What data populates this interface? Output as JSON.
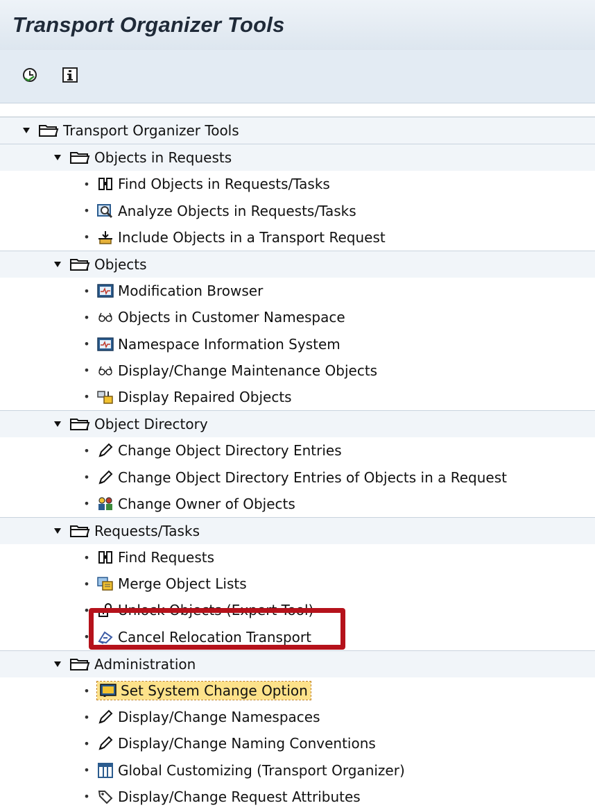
{
  "window": {
    "title": "Transport Organizer Tools"
  },
  "toolbar": {
    "execute_icon": "execute-clock-icon",
    "info_icon": "information-icon"
  },
  "tree": {
    "root": {
      "label": "Transport Organizer Tools"
    },
    "groups": [
      {
        "label": "Objects in Requests",
        "items": [
          {
            "label": "Find Objects in Requests/Tasks",
            "icon": "binoculars-icon"
          },
          {
            "label": "Analyze Objects in Requests/Tasks",
            "icon": "analyze-icon"
          },
          {
            "label": "Include Objects in a Transport Request",
            "icon": "include-arrow-icon"
          }
        ]
      },
      {
        "label": "Objects",
        "items": [
          {
            "label": "Modification Browser",
            "icon": "browser-chart-icon"
          },
          {
            "label": "Objects in Customer Namespace",
            "icon": "glasses-icon"
          },
          {
            "label": "Namespace Information System",
            "icon": "browser-chart-icon"
          },
          {
            "label": "Display/Change Maintenance Objects",
            "icon": "glasses-icon"
          },
          {
            "label": "Display Repaired Objects",
            "icon": "repaired-objects-icon"
          }
        ]
      },
      {
        "label": "Object Directory",
        "items": [
          {
            "label": "Change Object Directory Entries",
            "icon": "pencil-icon"
          },
          {
            "label": "Change Object Directory Entries of Objects in a Request",
            "icon": "pencil-icon"
          },
          {
            "label": "Change Owner of Objects",
            "icon": "users-icon"
          }
        ]
      },
      {
        "label": "Requests/Tasks",
        "items": [
          {
            "label": "Find Requests",
            "icon": "binoculars-icon"
          },
          {
            "label": "Merge Object Lists",
            "icon": "merge-lists-icon"
          },
          {
            "label": "Unlock Objects (Expert Tool)",
            "icon": "padlock-open-icon"
          },
          {
            "label": "Cancel Relocation Transport",
            "icon": "cancel-relocation-icon"
          }
        ]
      },
      {
        "label": "Administration",
        "items": [
          {
            "label": "Set System Change Option",
            "icon": "system-change-icon",
            "selected": true
          },
          {
            "label": "Display/Change Namespaces",
            "icon": "pencil-icon"
          },
          {
            "label": "Display/Change Naming Conventions",
            "icon": "pencil-icon"
          },
          {
            "label": "Global Customizing (Transport Organizer)",
            "icon": "table-grid-icon"
          },
          {
            "label": "Display/Change Request Attributes",
            "icon": "tag-icon"
          }
        ]
      }
    ]
  },
  "colors": {
    "highlight_border": "#b5121b",
    "selection_fill": "#fde28a",
    "node_row_bg": "#f1f5f9"
  }
}
